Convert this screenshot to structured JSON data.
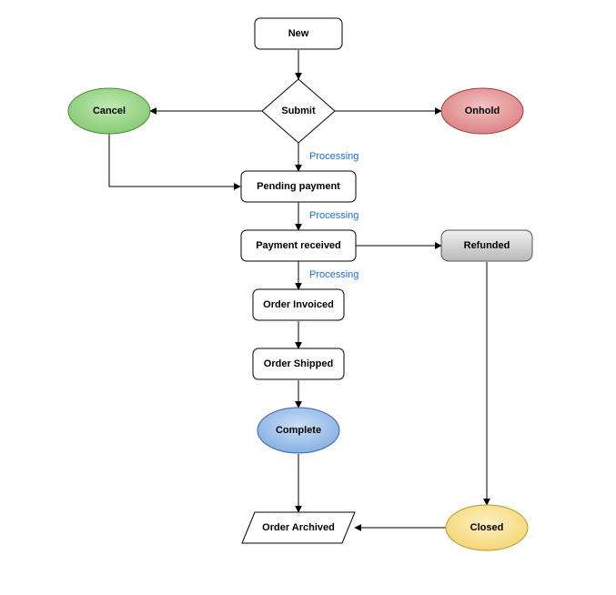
{
  "diagram": {
    "nodes": {
      "new": "New",
      "submit": "Submit",
      "cancel": "Cancel",
      "onhold": "Onhold",
      "pending_payment": "Pending payment",
      "payment_received": "Payment received",
      "refunded": "Refunded",
      "order_invoiced": "Order Invoiced",
      "order_shipped": "Order Shipped",
      "complete": "Complete",
      "order_archived": "Order Archived",
      "closed": "Closed"
    },
    "edge_labels": {
      "processing1": "Processing",
      "processing2": "Processing",
      "processing3": "Processing"
    }
  }
}
